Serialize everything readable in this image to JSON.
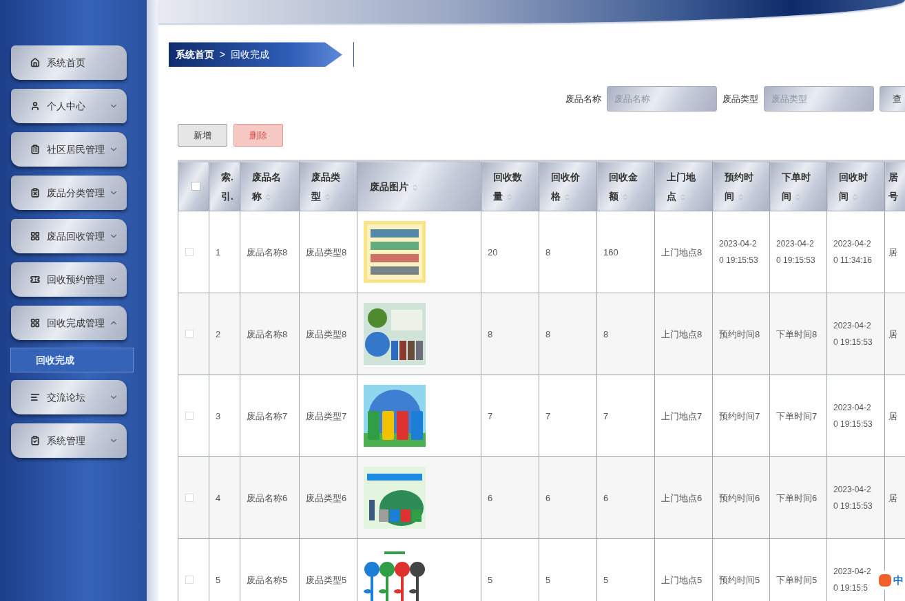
{
  "sidebar": {
    "items": [
      {
        "label": "系统首页",
        "kind": "link"
      },
      {
        "label": "个人中心",
        "kind": "menu",
        "expanded": false
      },
      {
        "label": "社区居民管理",
        "kind": "menu",
        "expanded": false
      },
      {
        "label": "废品分类管理",
        "kind": "menu",
        "expanded": false
      },
      {
        "label": "废品回收管理",
        "kind": "menu",
        "expanded": false
      },
      {
        "label": "回收预约管理",
        "kind": "menu",
        "expanded": false
      },
      {
        "label": "回收完成管理",
        "kind": "menu",
        "expanded": true,
        "children": [
          {
            "label": "回收完成",
            "selected": true
          }
        ]
      },
      {
        "label": "交流论坛",
        "kind": "menu",
        "expanded": false
      },
      {
        "label": "系统管理",
        "kind": "menu",
        "expanded": false
      }
    ]
  },
  "breadcrumb": [
    "系统首页",
    ">",
    "回收完成"
  ],
  "search": {
    "fields": [
      {
        "label": "废品名称",
        "placeholder": "废品名称"
      },
      {
        "label": "废品类型",
        "placeholder": "废品类型"
      }
    ],
    "button": "查"
  },
  "actions": [
    {
      "label": "新增",
      "kind": "add"
    },
    {
      "label": "删除",
      "kind": "delete"
    }
  ],
  "table": {
    "select_all": {
      "selected": false
    },
    "columns": [
      {
        "kind": "index",
        "label": "索.引."
      },
      {
        "kind": "text",
        "label": "废品名称"
      },
      {
        "kind": "text",
        "label": "废品类型"
      },
      {
        "label": "废品图片"
      },
      {
        "kind": "text",
        "label": "回收数量"
      },
      {
        "kind": "text",
        "label": "回收价格"
      },
      {
        "kind": "text",
        "label": "回收金额"
      },
      {
        "kind": "text",
        "label": "上门地点"
      },
      {
        "kind": "text",
        "label": "预约时间"
      },
      {
        "kind": "text",
        "label": "下单时间"
      },
      {
        "kind": "text",
        "label": "回收时间"
      },
      {
        "kind": "cut",
        "label": "居号"
      }
    ],
    "rows": [
      {
        "selected": false,
        "cells": [
          "1",
          "废品名称8",
          "废品类型8",
          "",
          "20",
          "8",
          "160",
          "上门地点8",
          "2023-04-20 19:15:53",
          "2023-04-20 19:15:53",
          "2023-04-20 11:34:16",
          "居"
        ]
      },
      {
        "selected": false,
        "cells": [
          "2",
          "废品名称8",
          "废品类型8",
          "",
          "8",
          "8",
          "8",
          "上门地点8",
          "预约时间8",
          "下单时间8",
          "2023-04-20 19:15:53",
          "居"
        ]
      },
      {
        "selected": false,
        "cells": [
          "3",
          "废品名称7",
          "废品类型7",
          "",
          "7",
          "7",
          "7",
          "上门地点7",
          "预约时间7",
          "下单时间7",
          "2023-04-20 19:15:53",
          "居"
        ]
      },
      {
        "selected": false,
        "cells": [
          "4",
          "废品名称6",
          "废品类型6",
          "",
          "6",
          "6",
          "6",
          "上门地点6",
          "预约时间6",
          "下单时间6",
          "2023-04-20 19:15:53",
          "居"
        ]
      },
      {
        "selected": false,
        "cells": [
          "5",
          "废品名称5",
          "废品类型5",
          "",
          "5",
          "5",
          "5",
          "上门地点5",
          "预约时间5",
          "下单时间5",
          "2023-04-20 19:15:5",
          ""
        ]
      }
    ]
  },
  "ime": {
    "label": "中"
  }
}
